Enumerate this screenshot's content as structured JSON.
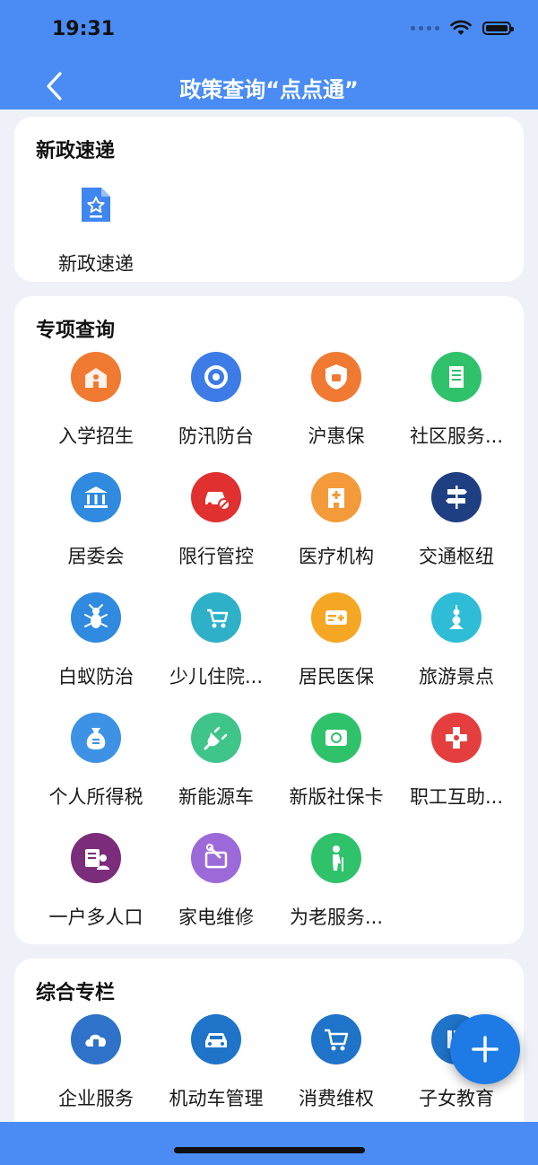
{
  "status": {
    "time": "19:31"
  },
  "header": {
    "title": "政策查询“点点通”"
  },
  "sections": [
    {
      "title": "新政速递",
      "items": [
        {
          "label": "新政速递",
          "icon": "document-star-icon",
          "color": "#3f86f0"
        }
      ]
    },
    {
      "title": "专项查询",
      "items": [
        {
          "label": "入学招生",
          "icon": "school-icon",
          "color": "#f07a32"
        },
        {
          "label": "防汛防台",
          "icon": "typhoon-icon",
          "color": "#3d7ce6"
        },
        {
          "label": "沪惠保",
          "icon": "shield-icon",
          "color": "#f07a32"
        },
        {
          "label": "社区服务...",
          "icon": "building-icon",
          "color": "#2fc26b"
        },
        {
          "label": "居委会",
          "icon": "bank-icon",
          "color": "#2f8ae0"
        },
        {
          "label": "限行管控",
          "icon": "car-forbidden-icon",
          "color": "#e03030"
        },
        {
          "label": "医疗机构",
          "icon": "hospital-icon",
          "color": "#f39a3a"
        },
        {
          "label": "交通枢纽",
          "icon": "signpost-icon",
          "color": "#1e3f82"
        },
        {
          "label": "白蚁防治",
          "icon": "termite-icon",
          "color": "#2f8ae0"
        },
        {
          "label": "少儿住院...",
          "icon": "stroller-icon",
          "color": "#2fb0c9"
        },
        {
          "label": "居民医保",
          "icon": "card-icon",
          "color": "#f5a623"
        },
        {
          "label": "旅游景点",
          "icon": "tower-icon",
          "color": "#2fbcd6"
        },
        {
          "label": "个人所得税",
          "icon": "tax-bag-icon",
          "color": "#3d92e6"
        },
        {
          "label": "新能源车",
          "icon": "charging-plug-icon",
          "color": "#3fc48a"
        },
        {
          "label": "新版社保卡",
          "icon": "social-card-icon",
          "color": "#2fc26b"
        },
        {
          "label": "职工互助...",
          "icon": "cross-icon",
          "color": "#e53e3e"
        },
        {
          "label": "一户多人口",
          "icon": "household-icon",
          "color": "#7b2c7a"
        },
        {
          "label": "家电维修",
          "icon": "tv-repair-icon",
          "color": "#9c6ad8"
        },
        {
          "label": "为老服务...",
          "icon": "elderly-icon",
          "color": "#2fc26b"
        }
      ]
    },
    {
      "title": "综合专栏",
      "items": [
        {
          "label": "企业服务",
          "icon": "cloud-building-icon",
          "color": "#2f72c9"
        },
        {
          "label": "机动车管理",
          "icon": "car-icon",
          "color": "#1f73c9"
        },
        {
          "label": "消费维权",
          "icon": "cart-icon",
          "color": "#1f73c9"
        },
        {
          "label": "子女教育",
          "icon": "books-icon",
          "color": "#1f73c9"
        }
      ]
    }
  ],
  "fab": {
    "icon": "plus-icon",
    "color": "#1e7be6"
  }
}
